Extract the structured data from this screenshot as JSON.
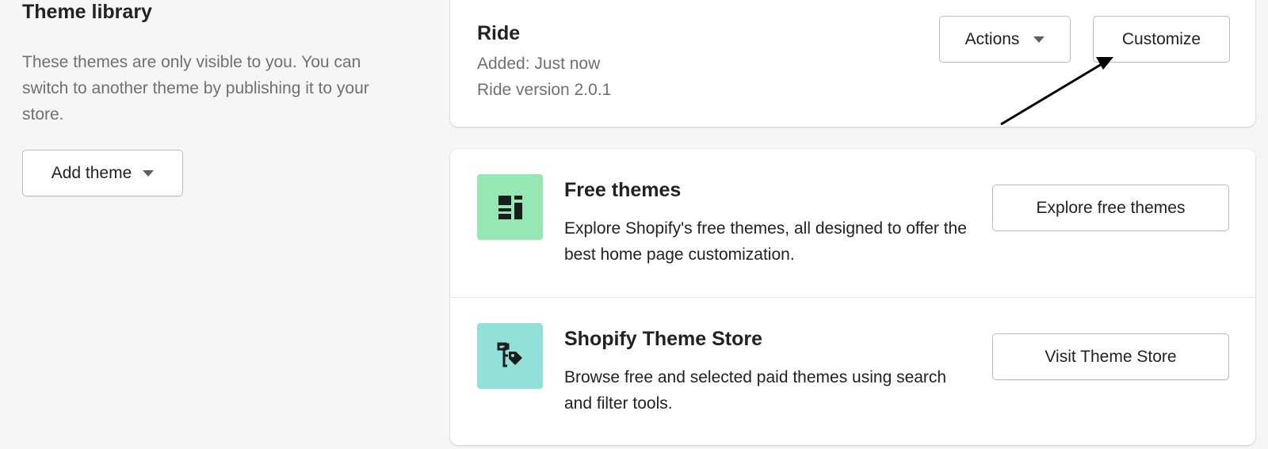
{
  "sidebar": {
    "title": "Theme library",
    "description": "These themes are only visible to you. You can switch to another theme by publishing it to your store.",
    "add_theme_label": "Add theme"
  },
  "theme_card": {
    "name": "Ride",
    "added": "Added: Just now",
    "version": "Ride version 2.0.1",
    "actions_label": "Actions",
    "customize_label": "Customize"
  },
  "explore": {
    "free": {
      "title": "Free themes",
      "description": "Explore Shopify's free themes, all designed to offer the best home page customization.",
      "button_label": "Explore free themes",
      "icon": "layout-blocks-icon",
      "tile_color": "#95e7b4"
    },
    "store": {
      "title": "Shopify Theme Store",
      "description": "Browse free and selected paid themes using search and filter tools.",
      "button_label": "Visit Theme Store",
      "icon": "store-tag-icon",
      "tile_color": "#92e1d8"
    }
  },
  "colors": {
    "background": "#f6f6f7",
    "text": "#202223",
    "subdued": "#6d7175"
  }
}
